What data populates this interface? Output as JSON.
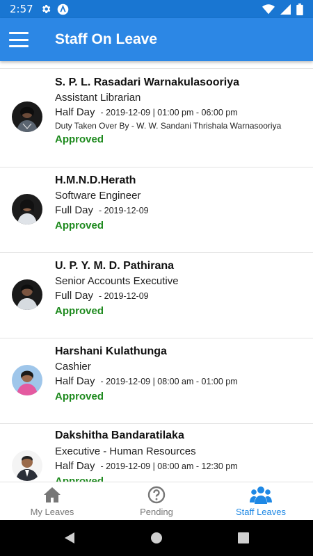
{
  "status_bar": {
    "time": "2:57"
  },
  "app_bar": {
    "title": "Staff On Leave"
  },
  "staff": [
    {
      "name": "S. P. L. Rasadari Warnakulasooriya",
      "designation": "Assistant Librarian",
      "leave_type": "Half Day",
      "leave_date": "- 2019-12-09 | 01:00 pm - 06:00 pm",
      "duty_taken_over": "Duty Taken Over By - W. W. Sandani Thrishala Warnasooriya",
      "status": "Approved"
    },
    {
      "name": "H.M.N.D.Herath",
      "designation": "Software Engineer",
      "leave_type": "Full Day",
      "leave_date": "- 2019-12-09",
      "status": "Approved"
    },
    {
      "name": "U. P. Y. M. D. Pathirana",
      "designation": "Senior Accounts Executive",
      "leave_type": "Full Day",
      "leave_date": "- 2019-12-09",
      "status": "Approved"
    },
    {
      "name": "Harshani Kulathunga",
      "designation": "Cashier",
      "leave_type": "Half Day",
      "leave_date": "- 2019-12-09 | 08:00 am - 01:00 pm",
      "status": "Approved"
    },
    {
      "name": "Dakshitha Bandaratilaka",
      "designation": "Executive - Human Resources",
      "leave_type": "Half Day",
      "leave_date": "- 2019-12-09 | 08:00 am - 12:30 pm",
      "status": "Approved"
    }
  ],
  "bottom_nav": {
    "items": [
      {
        "label": "My Leaves",
        "icon": "home-icon"
      },
      {
        "label": "Pending",
        "icon": "help-circle-icon"
      },
      {
        "label": "Staff Leaves",
        "icon": "group-icon"
      }
    ],
    "active": "Staff Leaves"
  },
  "colors": {
    "status_bar": "#1976D2",
    "app_bar": "#2C87E5",
    "approved": "#1E8A1E",
    "nav_active": "#1E88E5",
    "nav_inactive": "#777777"
  }
}
